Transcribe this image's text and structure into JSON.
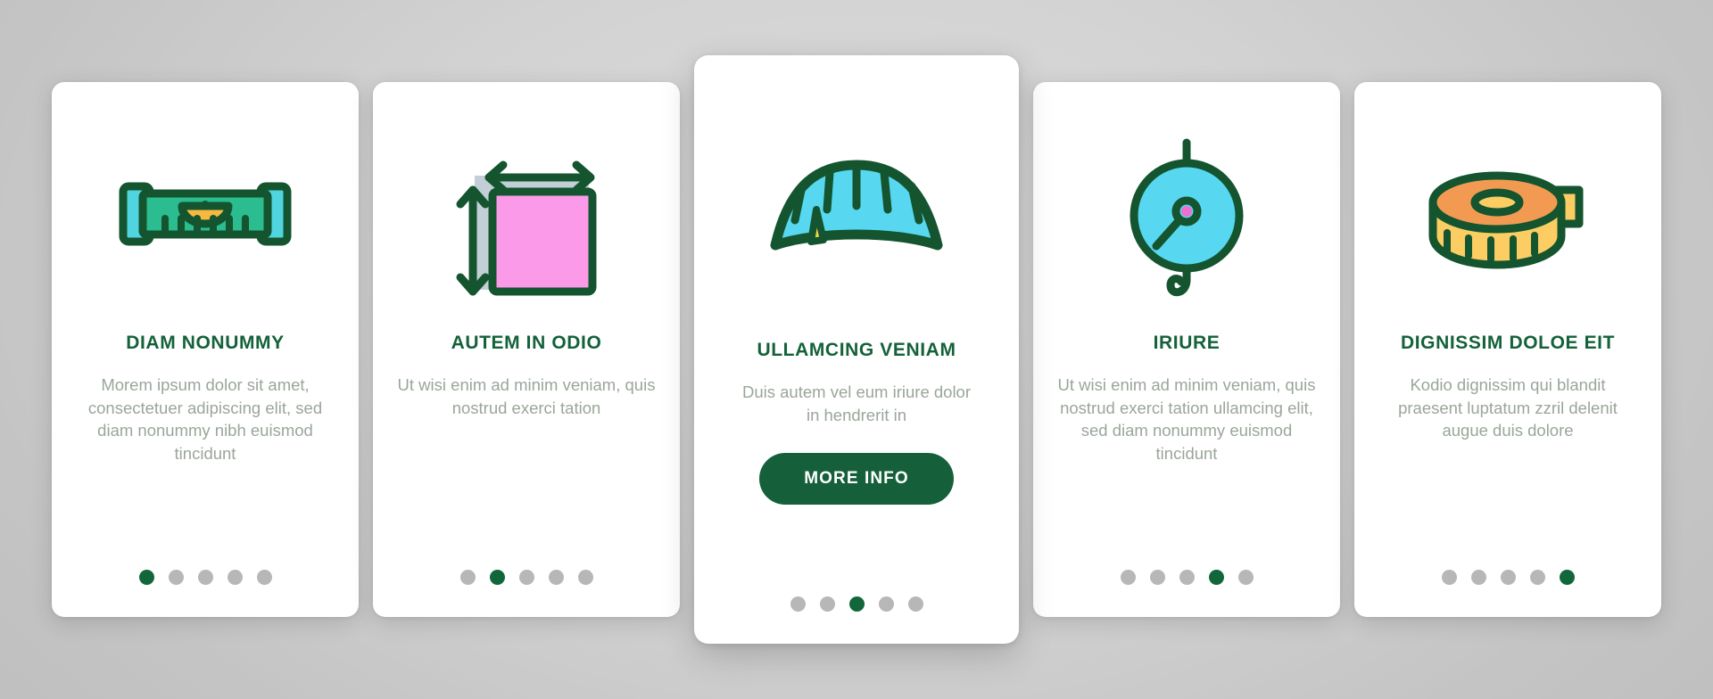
{
  "theme": {
    "brand_green": "#14613a",
    "button_green": "#15603a",
    "body_text_gray": "#9aa69a",
    "dot_inactive": "#b7b7b7",
    "dot_active": "#11673a",
    "card_background": "#ffffff",
    "page_background": "#c9c9c9",
    "icon_outline": "#14542f",
    "icon_teal": "#2bbd8f",
    "icon_cyan": "#57d8f0",
    "icon_orange": "#f5b942",
    "icon_pink": "#fa94e6",
    "icon_yellow": "#fbcd62",
    "icon_amber": "#f39a52",
    "icon_grayblue": "#c3cfd6"
  },
  "screens": [
    {
      "icon_name": "spirit-level-icon",
      "title": "DIAM NONUMMY",
      "body": "Morem ipsum dolor sit amet, consectetuer adipiscing elit, sed diam nonummy nibh euismod tincidunt",
      "featured": false,
      "dots_total": 5,
      "dot_active_index": 1
    },
    {
      "icon_name": "area-dimensions-icon",
      "title": "AUTEM IN ODIO",
      "body": "Ut wisi enim ad minim veniam, quis nostrud exerci tation",
      "featured": false,
      "dots_total": 5,
      "dot_active_index": 2
    },
    {
      "icon_name": "curved-measuring-tape-icon",
      "title": "ULLAMCING VENIAM",
      "body": "Duis autem vel eum iriure dolor in hendrerit in",
      "cta_label": "MORE INFO",
      "featured": true,
      "dots_total": 5,
      "dot_active_index": 3
    },
    {
      "icon_name": "hanging-scale-icon",
      "title": "IRIURE",
      "body": "Ut wisi enim ad minim veniam, quis nostrud exerci tation ullamcing elit, sed diam nonummy euismod tincidunt",
      "featured": false,
      "dots_total": 5,
      "dot_active_index": 4
    },
    {
      "icon_name": "tape-measure-roll-icon",
      "title": "DIGNISSIM DOLOE EIT",
      "body": "Kodio dignissim qui blandit praesent luptatum zzril delenit augue duis dolore",
      "featured": false,
      "dots_total": 5,
      "dot_active_index": 5
    }
  ]
}
